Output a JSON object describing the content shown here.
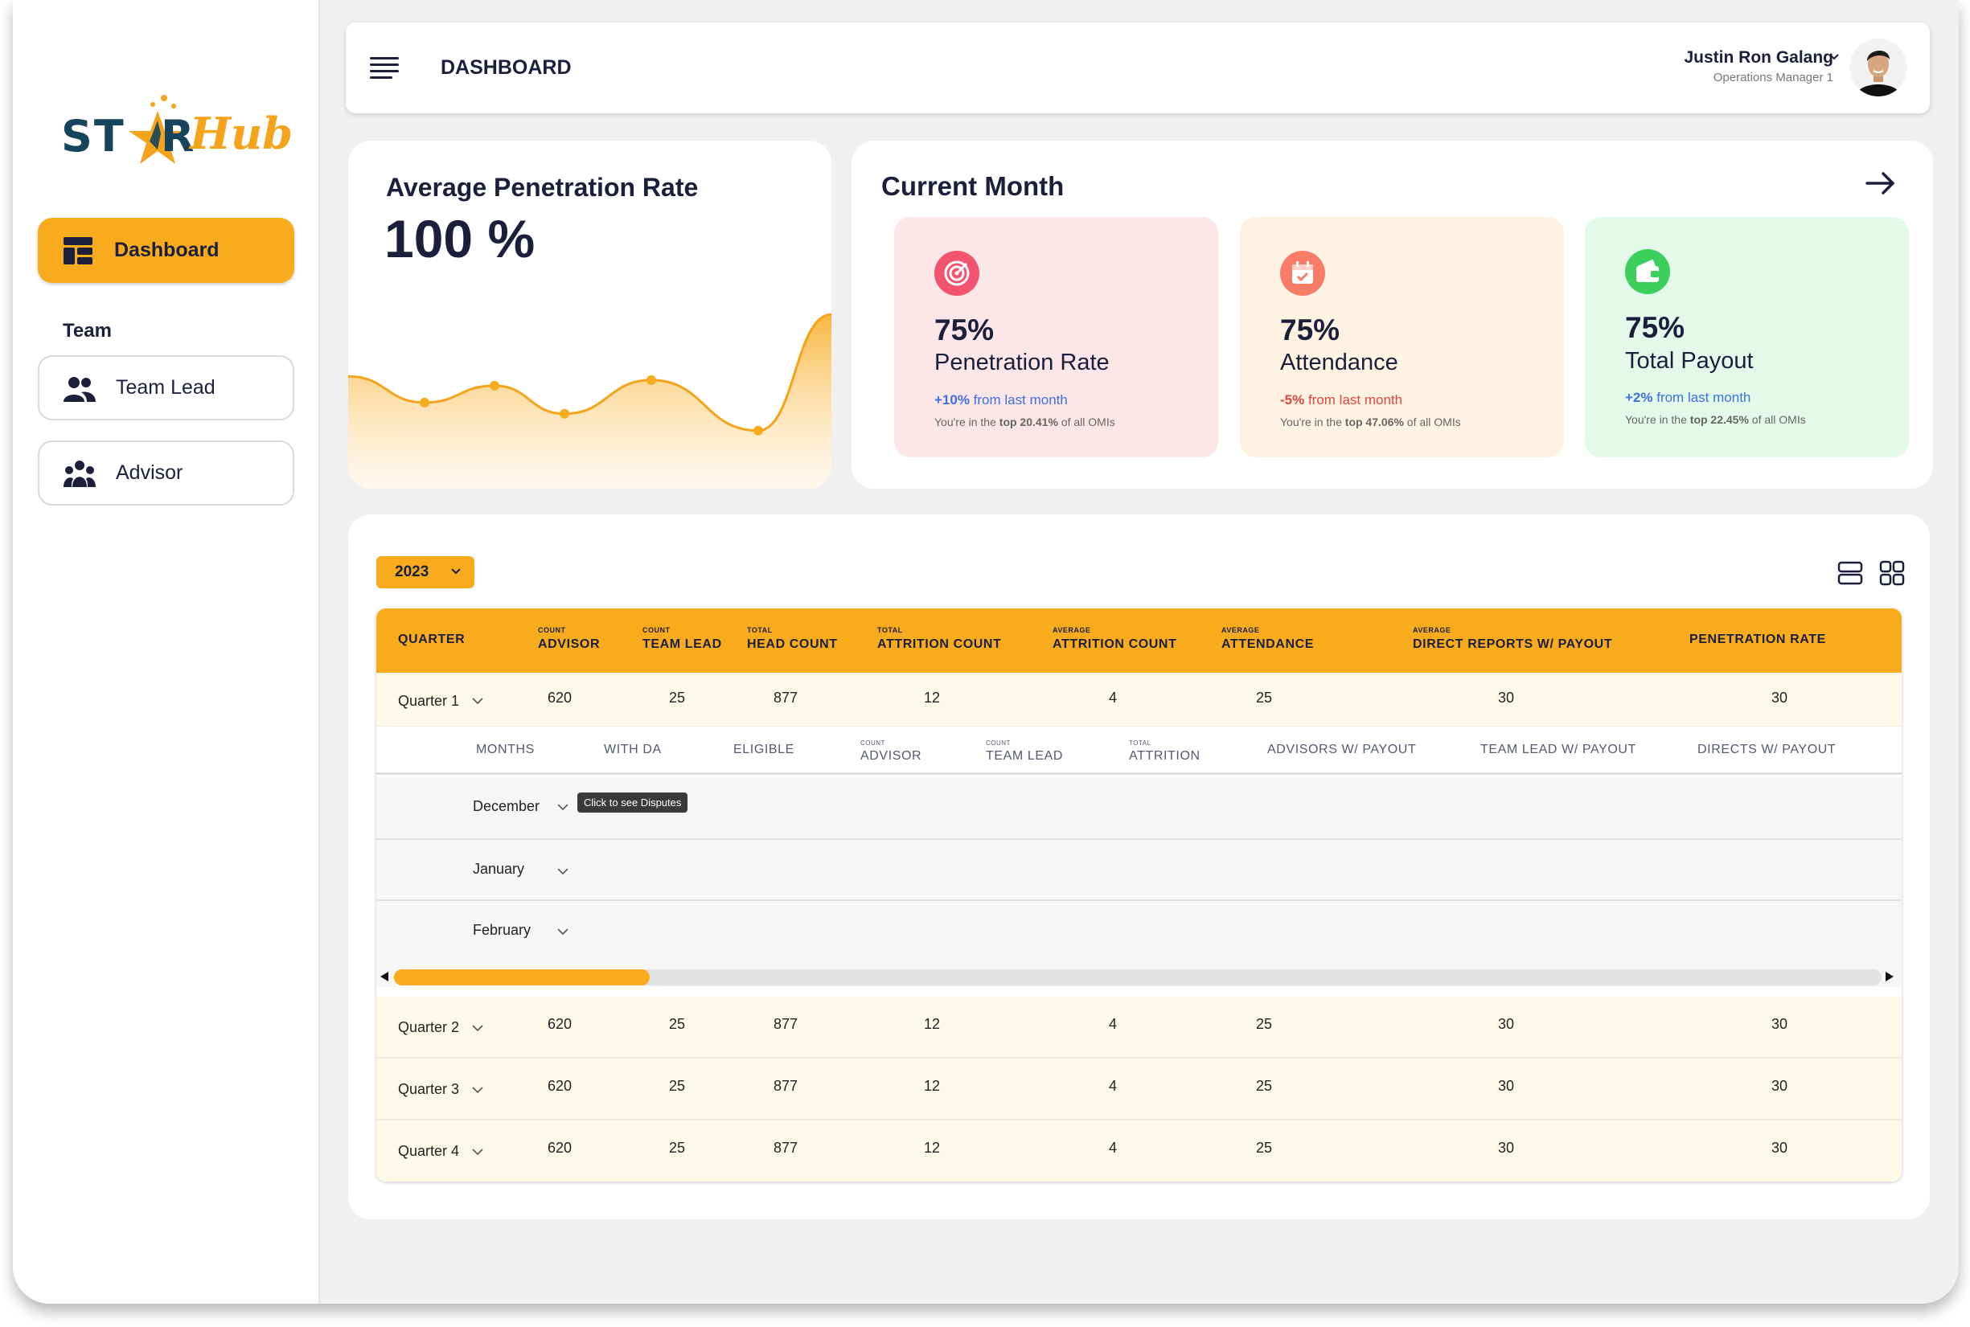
{
  "logo": {
    "text_left": "ST",
    "text_mid": "R",
    "text_right": "Hub"
  },
  "sidebar": {
    "dashboard_label": "Dashboard",
    "team_heading": "Team",
    "items": [
      {
        "label": "Team Lead",
        "icon": "team-lead-icon"
      },
      {
        "label": "Advisor",
        "icon": "advisor-group-icon"
      }
    ]
  },
  "header": {
    "title": "DASHBOARD",
    "user_name": "Justin Ron Galang",
    "user_role": "Operations Manager 1"
  },
  "avg_card": {
    "title": "Average Penetration Rate",
    "value": "100 %"
  },
  "current_month": {
    "title": "Current Month",
    "metrics": [
      {
        "value": "75%",
        "label": "Penetration Rate",
        "change": "+10%",
        "change_text": " from last month",
        "change_color": "#3e6fe0",
        "rank_prefix": "You're in the ",
        "rank_bold": "top 20.41%",
        "rank_suffix": " of all OMIs",
        "icon": "target-icon",
        "icon_color": "#f2546f"
      },
      {
        "value": "75%",
        "label": "Attendance",
        "change": "-5%",
        "change_text": " from last month",
        "change_color": "#e2453a",
        "rank_prefix": "You're in the ",
        "rank_bold": "top 47.06%",
        "rank_suffix": " of all OMIs",
        "icon": "calendar-icon",
        "icon_color": "#f97d66"
      },
      {
        "value": "75%",
        "label": "Total Payout",
        "change": "+2%",
        "change_text": " from last month",
        "change_color": "#3e6fe0",
        "rank_prefix": "You're in the ",
        "rank_bold": "top 22.45%",
        "rank_suffix": " of all OMIs",
        "icon": "wallet-icon",
        "icon_color": "#3ccf5b"
      }
    ]
  },
  "table": {
    "year": "2023",
    "headers": [
      {
        "sub": "",
        "main": "QUARTER"
      },
      {
        "sub": "COUNT",
        "main": "ADVISOR"
      },
      {
        "sub": "COUNT",
        "main": "TEAM LEAD"
      },
      {
        "sub": "TOTAL",
        "main": "HEAD COUNT"
      },
      {
        "sub": "TOTAL",
        "main": "ATTRITION COUNT"
      },
      {
        "sub": "AVERAGE",
        "main": "ATTRITION COUNT"
      },
      {
        "sub": "AVERAGE",
        "main": "ATTENDANCE"
      },
      {
        "sub": "AVERAGE",
        "main": "DIRECT REPORTS W/ PAYOUT"
      },
      {
        "sub": "",
        "main": "PENETRATION RATE"
      }
    ],
    "quarters": [
      {
        "label": "Quarter 1",
        "values": [
          "620",
          "25",
          "877",
          "12",
          "4",
          "25",
          "30",
          "30"
        ]
      },
      {
        "label": "Quarter 2",
        "values": [
          "620",
          "25",
          "877",
          "12",
          "4",
          "25",
          "30",
          "30"
        ]
      },
      {
        "label": "Quarter 3",
        "values": [
          "620",
          "25",
          "877",
          "12",
          "4",
          "25",
          "30",
          "30"
        ]
      },
      {
        "label": "Quarter 4",
        "values": [
          "620",
          "25",
          "877",
          "12",
          "4",
          "25",
          "30",
          "30"
        ]
      }
    ],
    "sub_headers": [
      {
        "sub": "",
        "main": "MONTHS"
      },
      {
        "sub": "",
        "main": "WITH DA"
      },
      {
        "sub": "",
        "main": "ELIGIBLE"
      },
      {
        "sub": "COUNT",
        "main": "ADVISOR"
      },
      {
        "sub": "COUNT",
        "main": "TEAM LEAD"
      },
      {
        "sub": "TOTAL",
        "main": "ATTRITION"
      },
      {
        "sub": "",
        "main": "ADVISORS W/ PAYOUT"
      },
      {
        "sub": "",
        "main": "TEAM LEAD W/ PAYOUT"
      },
      {
        "sub": "",
        "main": "DIRECTS W/ PAYOUT"
      }
    ],
    "months": [
      "December",
      "January",
      "February"
    ],
    "tooltip": "Click to see Disputes"
  },
  "chart_data": {
    "type": "area",
    "values": [
      null,
      46,
      55,
      40,
      58,
      31,
      null
    ],
    "color": "#f8ab1d"
  }
}
